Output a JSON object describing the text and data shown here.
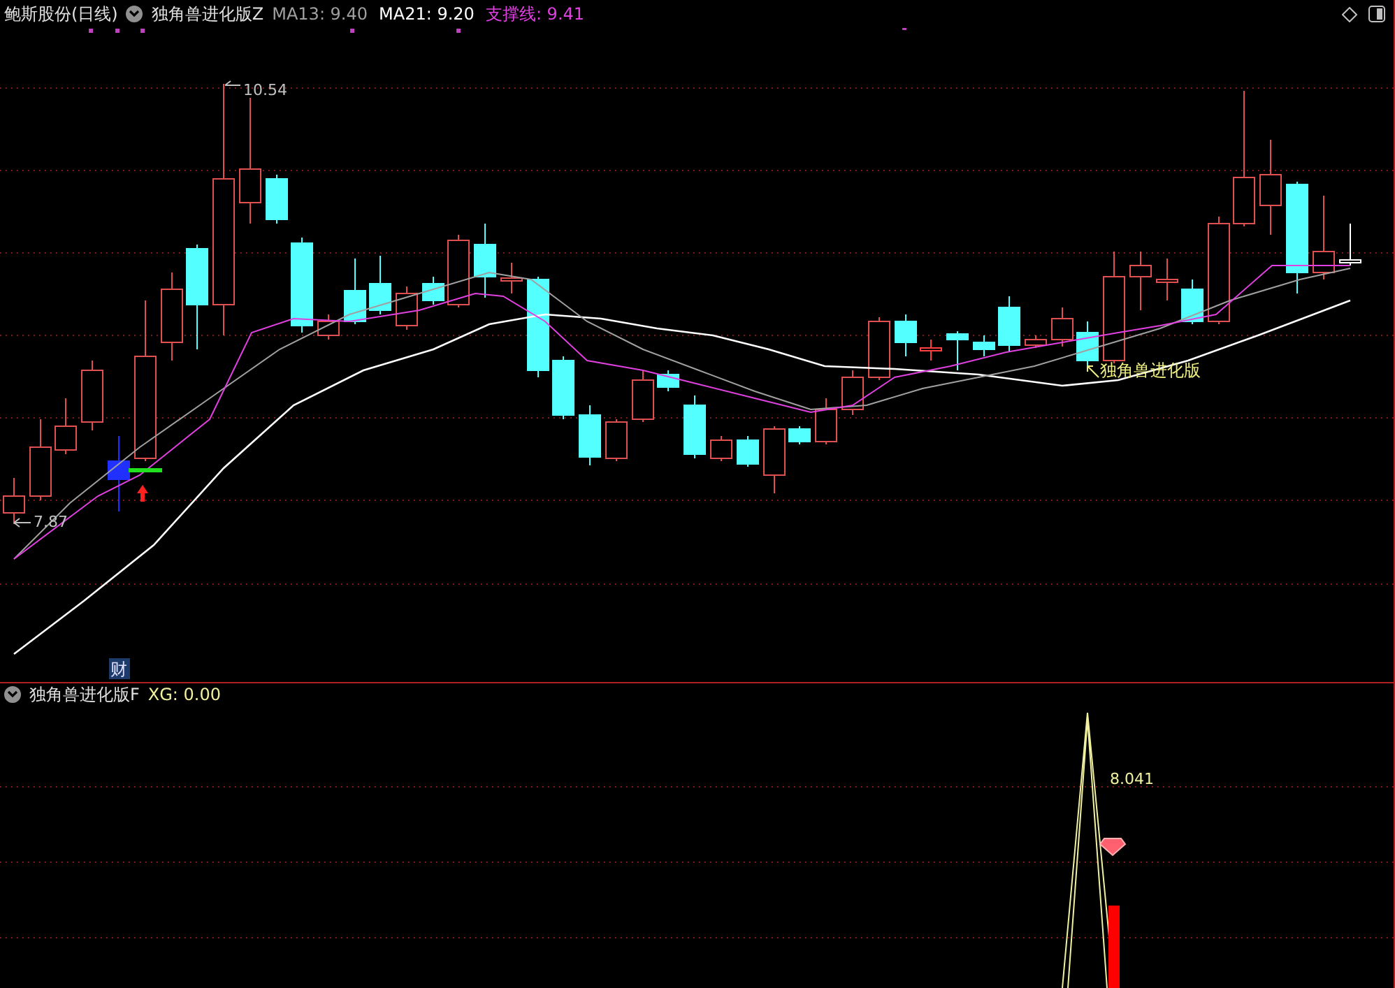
{
  "main_panel": {
    "title": "鲍斯股份(日线)",
    "indicator": "独角兽进化版Z",
    "readings": [
      {
        "label": "MA13: 9.40",
        "color": "#a0a0a0"
      },
      {
        "label": "MA21: 9.20",
        "color": "#ffffff"
      },
      {
        "label": "支撑线: 9.41",
        "color": "#e040e0"
      }
    ],
    "high_label": "10.54",
    "low_label": "7.87",
    "signal_label": "独角兽进化版",
    "badge": "财"
  },
  "lower_panel": {
    "indicator": "独角兽进化版F",
    "readings": [
      {
        "label": "XG: 0.00",
        "color": "#f0f0a0"
      }
    ],
    "peak_label": "8.041"
  }
}
